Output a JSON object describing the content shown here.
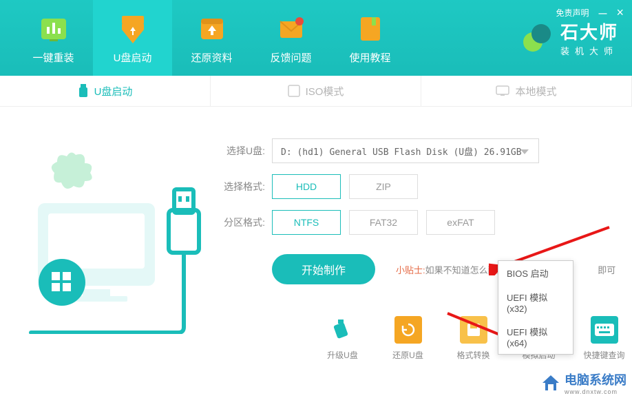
{
  "window": {
    "disclaimer": "免责声明",
    "minimize": "—",
    "close": "×"
  },
  "brand": {
    "name": "石大师",
    "subtitle": "装机大师"
  },
  "nav": [
    {
      "label": "一键重装"
    },
    {
      "label": "U盘启动"
    },
    {
      "label": "还原资料"
    },
    {
      "label": "反馈问题"
    },
    {
      "label": "使用教程"
    }
  ],
  "subtabs": [
    {
      "label": "U盘启动"
    },
    {
      "label": "ISO模式"
    },
    {
      "label": "本地模式"
    }
  ],
  "form": {
    "select_u_label": "选择U盘:",
    "select_u_value": "D: (hd1) General USB Flash Disk  (U盘) 26.91GB",
    "select_fmt_label": "选择格式:",
    "fmt_options": [
      "HDD",
      "ZIP"
    ],
    "part_fmt_label": "分区格式:",
    "part_options": [
      "NTFS",
      "FAT32",
      "exFAT"
    ]
  },
  "start": {
    "button": "开始制作",
    "hint_prefix": "小贴士:",
    "hint_text": "如果不知道怎么配置",
    "hint_suffix": "即可"
  },
  "bottom": [
    {
      "label": "升级U盘",
      "color": "#1abdb9"
    },
    {
      "label": "还原U盘",
      "color": "#f5a623"
    },
    {
      "label": "格式转换",
      "color": "#f8c14a"
    },
    {
      "label": "模拟启动",
      "color": "#1abdb9"
    },
    {
      "label": "快捷键查询",
      "color": "#1abdb9"
    }
  ],
  "popup": [
    "BIOS 启动",
    "UEFI 模拟(x32)",
    "UEFI 模拟(x64)"
  ],
  "watermark": {
    "text": "电脑系统网",
    "url": "www.dnxtw.com"
  }
}
